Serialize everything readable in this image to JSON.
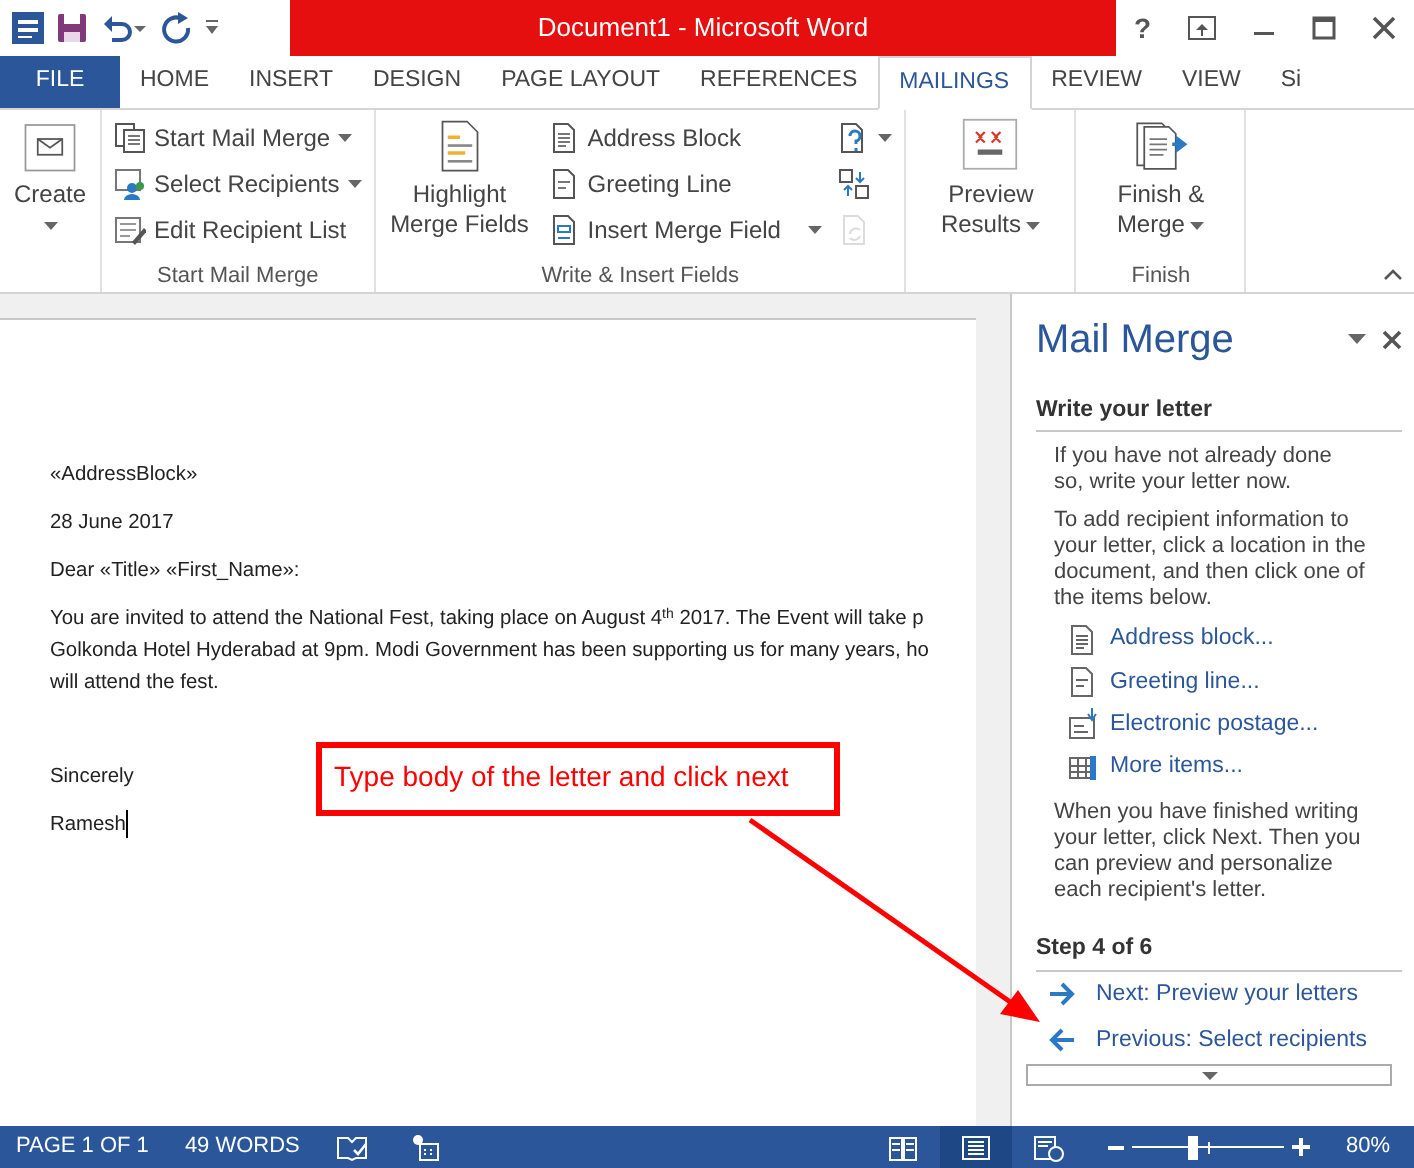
{
  "title_bar": {
    "title": "Document1 -  Microsoft Word",
    "help": "?"
  },
  "ribbon_tabs": [
    {
      "label": "FILE",
      "kind": "file",
      "selected": false
    },
    {
      "label": "HOME",
      "kind": "tab",
      "selected": false
    },
    {
      "label": "INSERT",
      "kind": "tab",
      "selected": false
    },
    {
      "label": "DESIGN",
      "kind": "tab",
      "selected": false
    },
    {
      "label": "PAGE LAYOUT",
      "kind": "tab",
      "selected": false
    },
    {
      "label": "REFERENCES",
      "kind": "tab",
      "selected": false
    },
    {
      "label": "MAILINGS",
      "kind": "tab",
      "selected": true
    },
    {
      "label": "REVIEW",
      "kind": "tab",
      "selected": false
    },
    {
      "label": "VIEW",
      "kind": "tab",
      "selected": false
    },
    {
      "label": "Si",
      "kind": "tab",
      "selected": false
    }
  ],
  "ribbon_groups": [
    {
      "columns": [
        [
          {
            "kind": "large",
            "label": "Create",
            "dropdown": true,
            "disabled": false
          }
        ]
      ]
    },
    {
      "label": "Start Mail Merge",
      "columns": [
        [
          {
            "kind": "small",
            "label": "Start Mail Merge",
            "dropdown": true,
            "disabled": false
          },
          {
            "kind": "small",
            "label": "Select Recipients",
            "dropdown": true,
            "disabled": false
          },
          {
            "kind": "small",
            "label": "Edit Recipient List",
            "dropdown": false,
            "disabled": false
          }
        ]
      ]
    },
    {
      "label": "Write & Insert Fields",
      "columns": [
        [
          {
            "kind": "large",
            "label": "Highlight Merge Fields",
            "dropdown": false,
            "disabled": false
          }
        ],
        [
          {
            "kind": "small",
            "label": "Address Block",
            "dropdown": false,
            "disabled": false
          },
          {
            "kind": "small",
            "label": "Greeting Line",
            "dropdown": false,
            "disabled": false
          },
          {
            "kind": "small",
            "label": "Insert Merge Field",
            "dropdown": true,
            "disabled": false
          }
        ],
        [
          {
            "kind": "icon",
            "dropdown": true,
            "disabled": false
          },
          {
            "kind": "icon",
            "dropdown": false,
            "disabled": false
          },
          {
            "kind": "icon",
            "dropdown": false,
            "disabled": true
          }
        ]
      ]
    },
    {
      "columns": [
        [
          {
            "kind": "large",
            "label": "Preview Results",
            "dropdown": true,
            "disabled": false
          }
        ]
      ]
    },
    {
      "label": "Finish",
      "columns": [
        [
          {
            "kind": "large",
            "label": "Finish & Merge",
            "dropdown": true,
            "disabled": false
          }
        ]
      ]
    }
  ],
  "document": {
    "paragraphs": [
      {
        "lines": [
          "«AddressBlock»"
        ],
        "kind": "text",
        "cursor": false
      },
      {
        "lines": [
          "28 June 2017"
        ],
        "kind": "text",
        "cursor": false
      },
      {
        "lines": [
          "Dear «Title» «First_Name»:"
        ],
        "kind": "text",
        "cursor": false
      },
      {
        "lines": [
          "You are invited to attend the National Fest, taking place on August 4$^{th}$ 2017. The Event will take p",
          "Golkonda Hotel Hyderabad at 9pm. Modi Government has been supporting us for many years, ho",
          "will attend the fest."
        ],
        "kind": "text",
        "cursor": false
      },
      {
        "lines": [
          "Sincerely"
        ],
        "kind": "closing",
        "cursor": false
      },
      {
        "lines": [
          "Ramesh"
        ],
        "kind": "text",
        "cursor": true
      }
    ]
  },
  "annotation": {
    "text": "Type body of the letter and click next"
  },
  "task_pane": {
    "title": "Mail Merge",
    "heading": "Write your letter",
    "paragraphs": [
      "If you have not already done so, write your letter now.",
      "To add recipient information to your letter, click a location in the document, and then click one of the items below."
    ],
    "items": [
      "Address block...",
      "Greeting line...",
      "Electronic postage...",
      "More items..."
    ],
    "closing": "When you have finished writing your letter, click Next. Then you can preview and personalize each recipient's letter.",
    "step": "Step 4 of 6",
    "navigation": [
      {
        "label": "Next: Preview your letters",
        "kind": "next"
      },
      {
        "label": "Previous: Select recipients",
        "kind": "previous"
      }
    ]
  },
  "status_bar": {
    "page": "PAGE 1 OF 1",
    "words": "49 WORDS",
    "views": [
      {
        "kind": "read",
        "selected": false
      },
      {
        "kind": "print",
        "selected": true
      },
      {
        "kind": "web",
        "selected": false
      }
    ],
    "zoom": {
      "level": 0.4,
      "reading": "80%"
    }
  }
}
